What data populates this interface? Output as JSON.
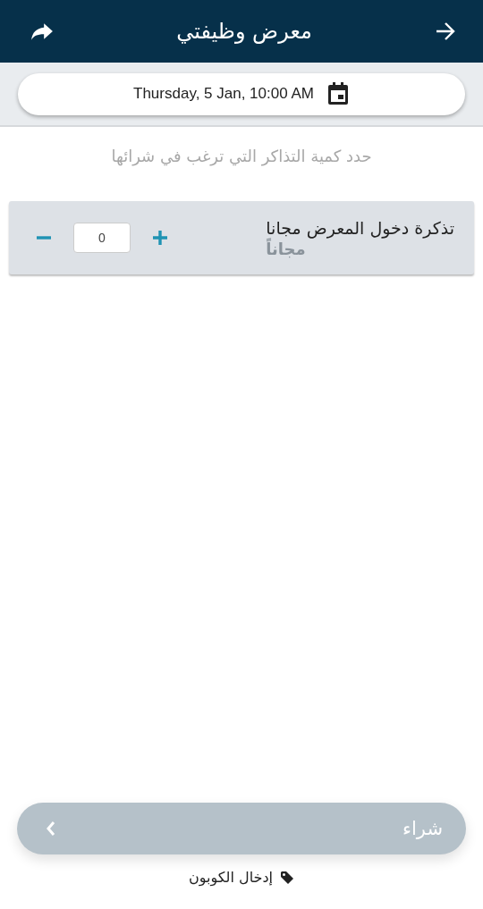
{
  "header": {
    "title": "معرض وظيفتي"
  },
  "date_selector": {
    "value": "Thursday, 5 Jan, 10:00 AM"
  },
  "instruction": "حدد كمية التذاكر التي ترغب في شرائها",
  "tickets": [
    {
      "name": "تذكرة دخول المعرض مجانا",
      "price": "مجاناً",
      "quantity": "0"
    }
  ],
  "buy_button": {
    "label": "شراء",
    "disabled": true
  },
  "coupon_link": "إدخال الكوبون"
}
